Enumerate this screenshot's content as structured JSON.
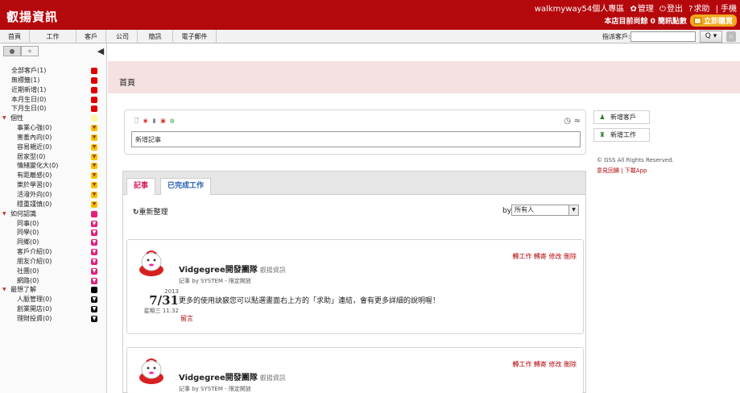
{
  "app": {
    "logo": "叡揚資訊"
  },
  "topbar": {
    "user": "walkmyway54",
    "links": [
      "個人專區",
      "管理",
      "登出",
      "求助",
      "手機"
    ],
    "status": "本店目前尚餘 0 簡訊點數",
    "buy": "立即購買"
  },
  "nav": {
    "tabs": [
      "首頁",
      "工作",
      "客戶",
      "公司",
      "簡訊",
      "電子郵件"
    ],
    "assign_label": "指派客戶:",
    "assign_value": "",
    "search_button": "Q ▾"
  },
  "sidebar": {
    "items": [
      {
        "label": "全部客戶(1)",
        "type": "top",
        "color": "#e00000"
      },
      {
        "label": "無標籤(1)",
        "type": "top",
        "color": "#e00000"
      },
      {
        "label": "近期新增(1)",
        "type": "top",
        "color": "#e00000"
      },
      {
        "label": "本月生日(0)",
        "type": "top",
        "color": "#e00000"
      },
      {
        "label": "下月生日(0)",
        "type": "top",
        "color": "#e00000"
      },
      {
        "label": "個性",
        "type": "group",
        "color": "#fff8a8"
      },
      {
        "label": "事業心強(0)",
        "type": "sub",
        "color": "#f4c400"
      },
      {
        "label": "害羞內向(0)",
        "type": "sub",
        "color": "#f4c400"
      },
      {
        "label": "容易親近(0)",
        "type": "sub",
        "color": "#f4c400"
      },
      {
        "label": "居家型(0)",
        "type": "sub",
        "color": "#f4c400"
      },
      {
        "label": "情緒變化大(0)",
        "type": "sub",
        "color": "#f4c400"
      },
      {
        "label": "有距離感(0)",
        "type": "sub",
        "color": "#f4c400"
      },
      {
        "label": "樂於學習(0)",
        "type": "sub",
        "color": "#f4c400"
      },
      {
        "label": "活潑外向(0)",
        "type": "sub",
        "color": "#f4c400"
      },
      {
        "label": "穩重謹慎(0)",
        "type": "sub",
        "color": "#f4c400"
      },
      {
        "label": "如何認識",
        "type": "group",
        "color": "#e0207a"
      },
      {
        "label": "同事(0)",
        "type": "sub",
        "color": "#e0207a"
      },
      {
        "label": "同學(0)",
        "type": "sub",
        "color": "#e0207a"
      },
      {
        "label": "同鄉(0)",
        "type": "sub",
        "color": "#e0207a"
      },
      {
        "label": "客戶介紹(0)",
        "type": "sub",
        "color": "#e0207a"
      },
      {
        "label": "朋友介紹(0)",
        "type": "sub",
        "color": "#e0207a"
      },
      {
        "label": "社團(0)",
        "type": "sub",
        "color": "#e0207a"
      },
      {
        "label": "網路(0)",
        "type": "sub",
        "color": "#e0207a"
      },
      {
        "label": "最想了解",
        "type": "group",
        "color": "#000000"
      },
      {
        "label": "人脈管理(0)",
        "type": "sub",
        "color": "#111111"
      },
      {
        "label": "創業開店(0)",
        "type": "sub",
        "color": "#111111"
      },
      {
        "label": "理財投資(0)",
        "type": "sub",
        "color": "#111111"
      }
    ]
  },
  "main": {
    "page_title": "首頁",
    "post_placeholder": "新增記事",
    "actions": [
      "新增客戶",
      "新增工作"
    ],
    "copyright": "© GSS All Rights Reserved.",
    "footer_links": "意見回饋 | 下載App",
    "tabs": [
      "記事",
      "已完成工作"
    ],
    "refresh": "重新整理",
    "by_label": "by",
    "by_value": "所有人",
    "posts": [
      {
        "author": "Vidgegree開發團隊",
        "group": "叡揚資訊",
        "meta": "記事 by SYSTEM - 限定開放",
        "actions": "轉工作 轉寄 修改 刪除",
        "year": "2013",
        "date": "7/31",
        "time": "星期三 11:32",
        "content": "更多的使用訣竅您可以點選畫面右上方的「求助」連結，會有更多詳細的說明喔！",
        "comment": "留言"
      },
      {
        "author": "Vidgegree開發團隊",
        "group": "叡揚資訊",
        "meta": "記事 by SYSTEM - 限定開放",
        "actions": "轉工作 轉寄 修改 刪除",
        "year": "",
        "date": "",
        "time": "",
        "content": "",
        "comment": ""
      }
    ]
  }
}
